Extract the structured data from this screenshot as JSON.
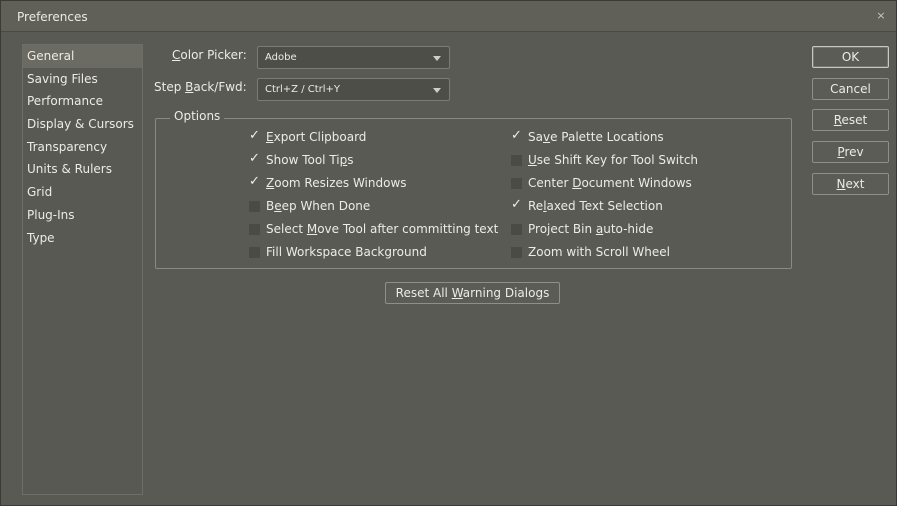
{
  "window": {
    "title": "Preferences",
    "close_glyph": "×"
  },
  "sidebar": {
    "items": [
      {
        "label": "General",
        "selected": true
      },
      {
        "label": "Saving Files",
        "selected": false
      },
      {
        "label": "Performance",
        "selected": false
      },
      {
        "label": "Display & Cursors",
        "selected": false
      },
      {
        "label": "Transparency",
        "selected": false
      },
      {
        "label": "Units & Rulers",
        "selected": false
      },
      {
        "label": "Grid",
        "selected": false
      },
      {
        "label": "Plug-Ins",
        "selected": false
      },
      {
        "label": "Type",
        "selected": false
      }
    ]
  },
  "fields": {
    "color_picker": {
      "label_pre": "",
      "label_u": "C",
      "label_post": "olor Picker:",
      "value": "Adobe"
    },
    "step_back": {
      "label_pre": "Step ",
      "label_u": "B",
      "label_post": "ack/Fwd:",
      "value": "Ctrl+Z / Ctrl+Y"
    }
  },
  "options": {
    "title": "Options",
    "left": [
      {
        "pre": "",
        "u": "E",
        "post": "xport Clipboard",
        "checked": true
      },
      {
        "pre": "Show Tool Ti",
        "u": "p",
        "post": "s",
        "checked": true
      },
      {
        "pre": "",
        "u": "Z",
        "post": "oom Resizes Windows",
        "checked": true
      },
      {
        "pre": "B",
        "u": "e",
        "post": "ep When Done",
        "checked": false
      },
      {
        "pre": "Select ",
        "u": "M",
        "post": "ove Tool after committing text",
        "checked": false
      },
      {
        "pre": "Fill Workspace Background",
        "u": "",
        "post": "",
        "checked": false
      }
    ],
    "right": [
      {
        "pre": "Sa",
        "u": "v",
        "post": "e Palette Locations",
        "checked": true
      },
      {
        "pre": "",
        "u": "U",
        "post": "se Shift Key for Tool Switch",
        "checked": false
      },
      {
        "pre": "Center ",
        "u": "D",
        "post": "ocument Windows",
        "checked": false
      },
      {
        "pre": "Re",
        "u": "l",
        "post": "axed Text Selection",
        "checked": true
      },
      {
        "pre": "Project Bin ",
        "u": "a",
        "post": "uto-hide",
        "checked": false
      },
      {
        "pre": "Zoom with Scroll Wheel",
        "u": "",
        "post": "",
        "checked": false
      }
    ]
  },
  "reset_warnings": {
    "pre": "Reset All ",
    "u": "W",
    "post": "arning Dialogs"
  },
  "buttons": {
    "ok": {
      "pre": "OK",
      "u": "",
      "post": ""
    },
    "cancel": {
      "pre": "Cancel",
      "u": "",
      "post": ""
    },
    "reset": {
      "pre": "",
      "u": "R",
      "post": "eset"
    },
    "prev": {
      "pre": "",
      "u": "P",
      "post": "rev"
    },
    "next": {
      "pre": "",
      "u": "N",
      "post": "ext"
    }
  }
}
